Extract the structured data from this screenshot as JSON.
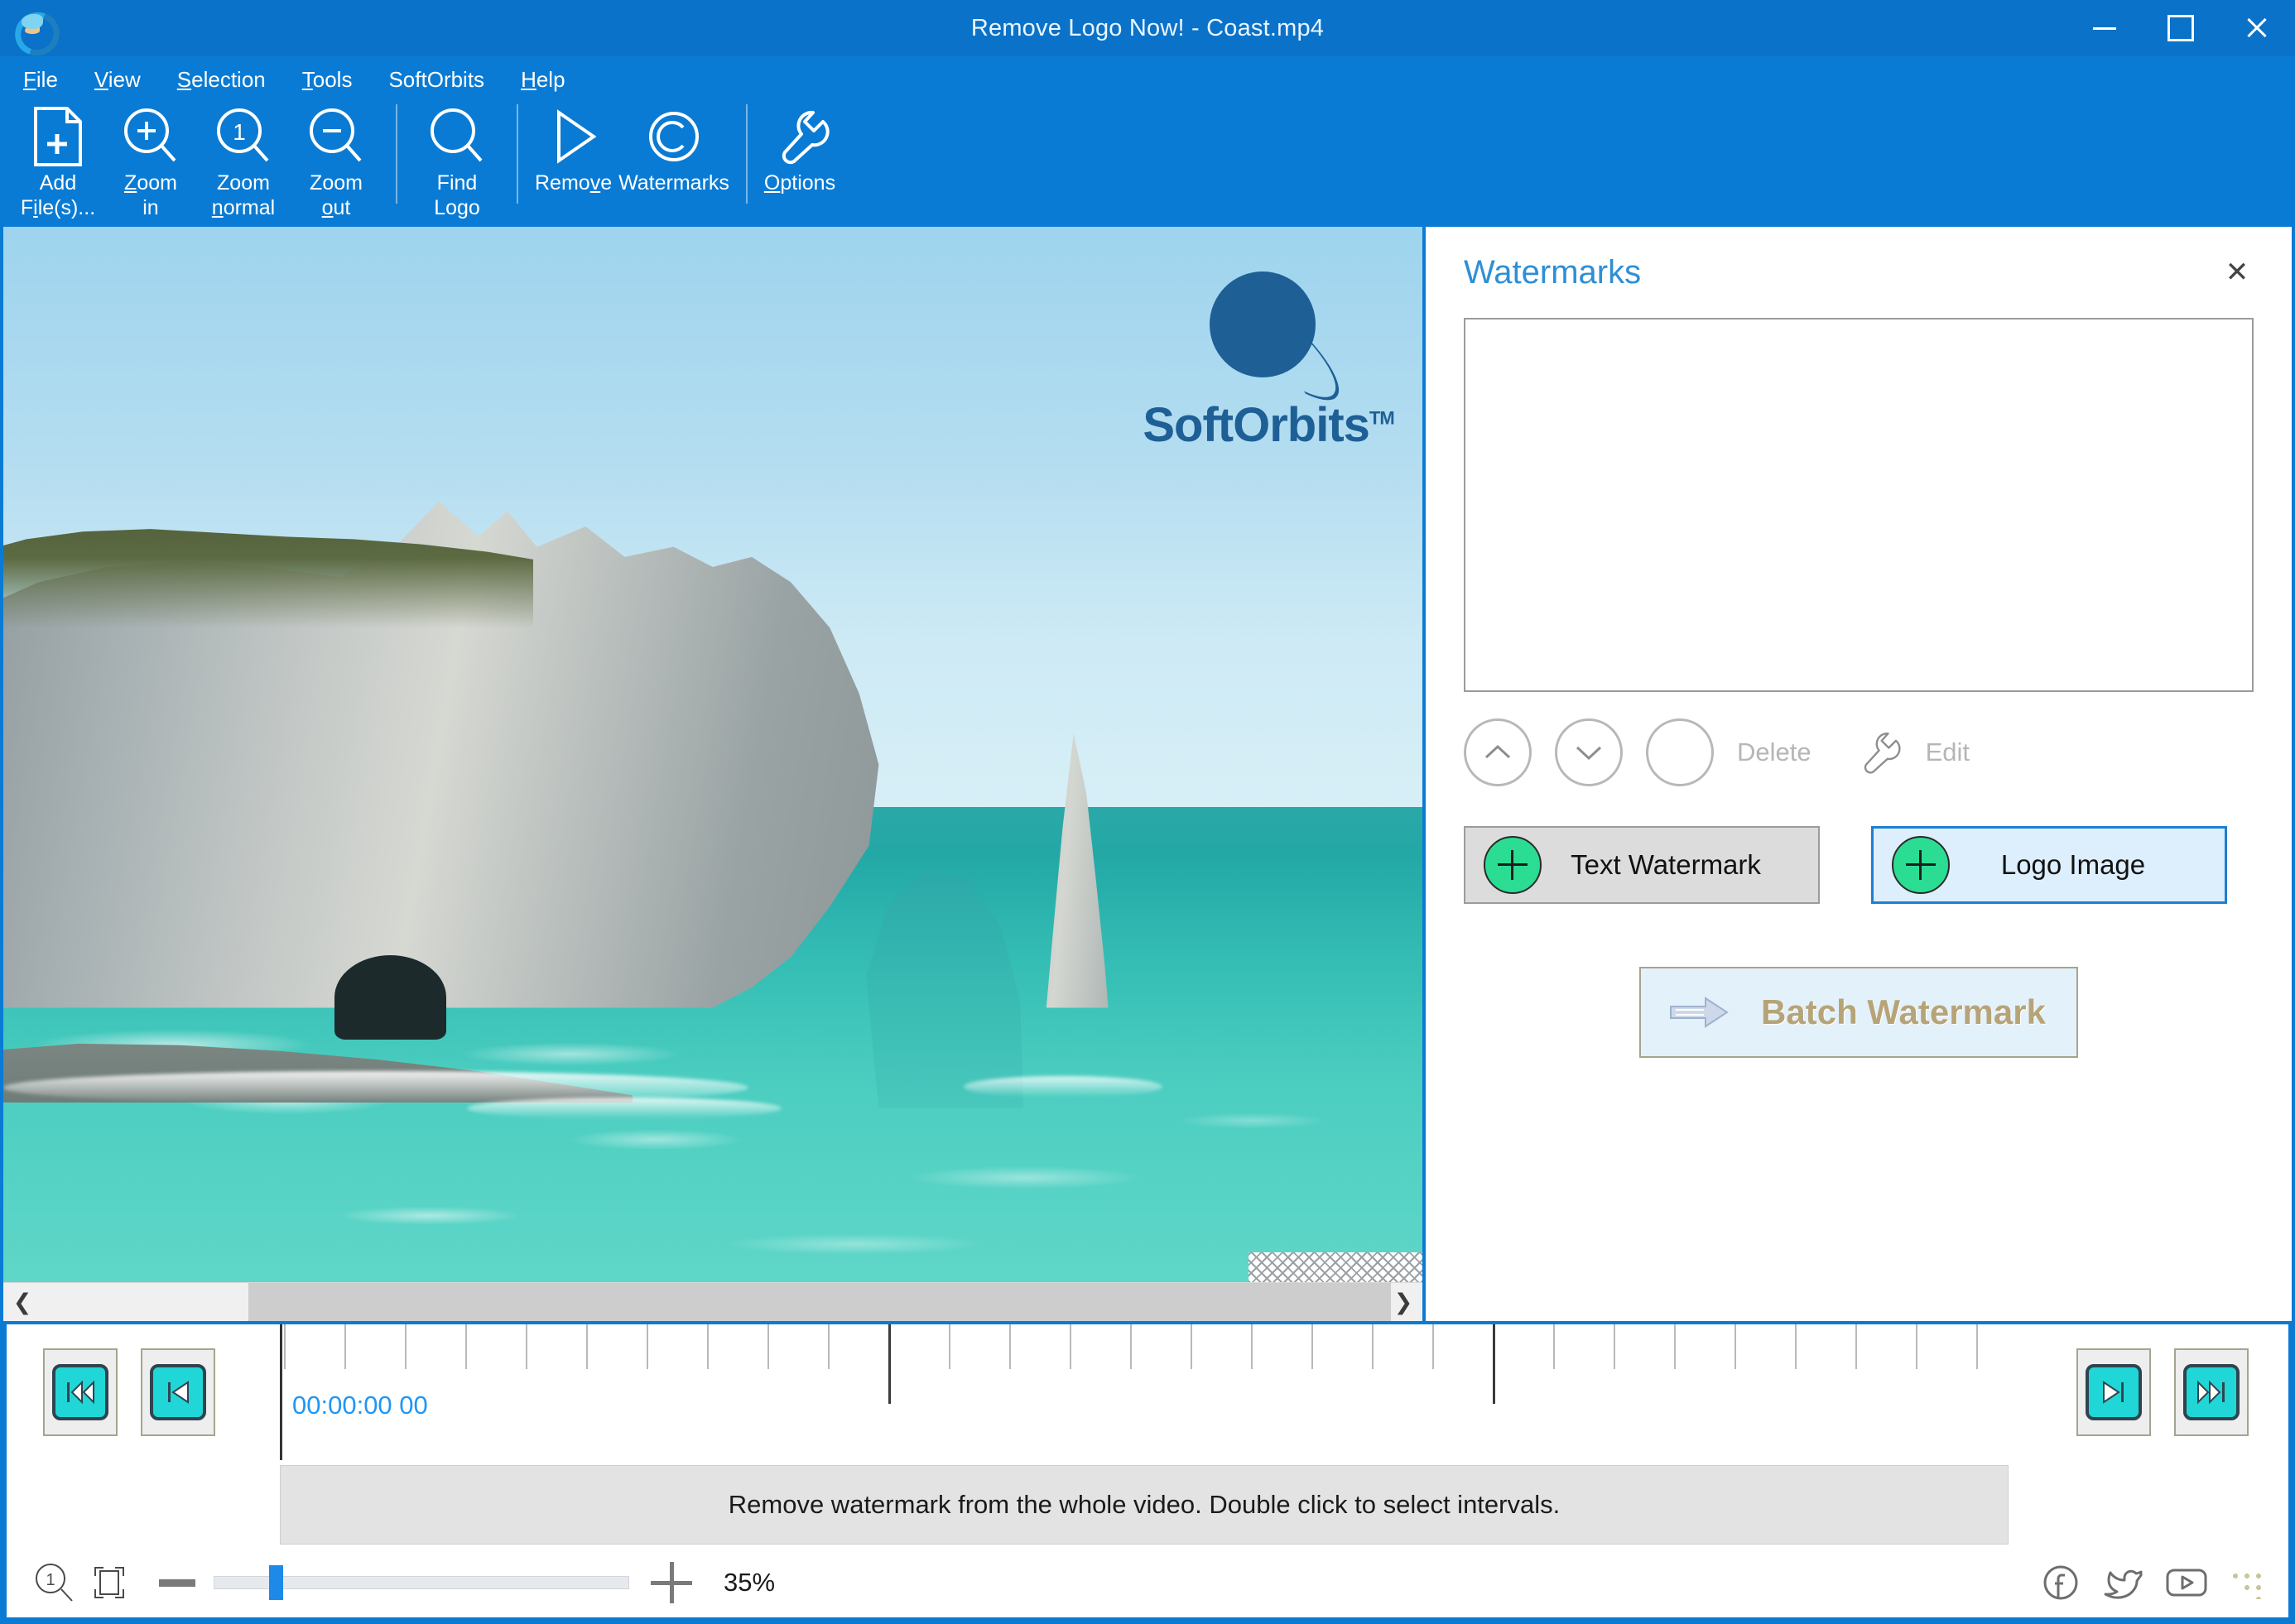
{
  "window": {
    "title": "Remove Logo Now! - Coast.mp4",
    "app_icon": "dolphin-app-icon",
    "minimize_label": "Minimize",
    "maximize_label": "Maximize",
    "close_label": "Close",
    "titlebar_color": "#0a72c8",
    "chrome_color": "#0a7bd4"
  },
  "menu": {
    "items": [
      {
        "label": "File",
        "accel": "F"
      },
      {
        "label": "View",
        "accel": "V"
      },
      {
        "label": "Selection",
        "accel": "S"
      },
      {
        "label": "Tools",
        "accel": "T"
      },
      {
        "label": "SoftOrbits",
        "accel": ""
      },
      {
        "label": "Help",
        "accel": "H"
      }
    ]
  },
  "toolbar": {
    "groups": [
      {
        "buttons": [
          {
            "label": "Add\nFile(s)...",
            "icon": "add-file-icon"
          },
          {
            "label": "Zoom\nin",
            "icon": "zoom-in-icon"
          },
          {
            "label": "Zoom\nnormal",
            "icon": "zoom-normal-icon"
          },
          {
            "label": "Zoom\nout",
            "icon": "zoom-out-icon"
          }
        ]
      },
      {
        "buttons": [
          {
            "label": "Find\nLogo",
            "icon": "find-logo-icon"
          }
        ]
      },
      {
        "buttons": [
          {
            "label": "Remove",
            "icon": "play-triangle-icon"
          },
          {
            "label": "Watermarks",
            "icon": "copyright-icon"
          }
        ]
      },
      {
        "buttons": [
          {
            "label": "Options",
            "icon": "wrench-icon"
          }
        ]
      }
    ]
  },
  "canvas": {
    "watermark_text": "SoftOrbits",
    "watermark_tm": "TM",
    "watermark_icon": "saturn-planet-icon",
    "scroll_left_icon": "chevron-left-icon",
    "scroll_right_icon": "chevron-right-icon"
  },
  "panel": {
    "title": "Watermarks",
    "close_icon": "close-icon",
    "list_items": [],
    "tools": [
      {
        "name": "move-up",
        "icon": "chevron-up-icon",
        "label": ""
      },
      {
        "name": "move-down",
        "icon": "chevron-down-icon",
        "label": ""
      },
      {
        "name": "delete",
        "icon": "empty-circle-icon",
        "label": "Delete"
      },
      {
        "name": "edit",
        "icon": "wrench-icon",
        "label": "Edit"
      }
    ],
    "delete_label": "Delete",
    "edit_label": "Edit",
    "add_buttons": [
      {
        "label": "Text Watermark",
        "icon": "plus-circle-icon",
        "style": "grey"
      },
      {
        "label": "Logo Image",
        "icon": "plus-circle-icon",
        "style": "blue"
      }
    ],
    "batch_button": {
      "label": "Batch Watermark",
      "icon": "arrow-right-icon"
    }
  },
  "timeline": {
    "current_time": "00:00:00 00",
    "left_buttons": [
      {
        "name": "jump-to-start",
        "icon": "skip-back-double-icon"
      },
      {
        "name": "step-back",
        "icon": "skip-back-icon"
      }
    ],
    "right_buttons": [
      {
        "name": "step-forward",
        "icon": "skip-forward-icon"
      },
      {
        "name": "jump-to-end",
        "icon": "skip-forward-double-icon"
      }
    ],
    "tick_count": 29,
    "major_every": 10
  },
  "hint": {
    "text": "Remove watermark from the whole video. Double click to select intervals."
  },
  "zoombar": {
    "zoom_normal_icon": "zoom-one-icon",
    "fit_icon": "fit-to-window-icon",
    "minus_icon": "minus-icon",
    "plus_icon": "plus-icon",
    "zoom_value": "35%",
    "slider_percent": 13,
    "social": [
      {
        "name": "facebook-icon"
      },
      {
        "name": "twitter-icon"
      },
      {
        "name": "youtube-icon"
      }
    ],
    "resize_grip_icon": "resize-grip-icon"
  }
}
